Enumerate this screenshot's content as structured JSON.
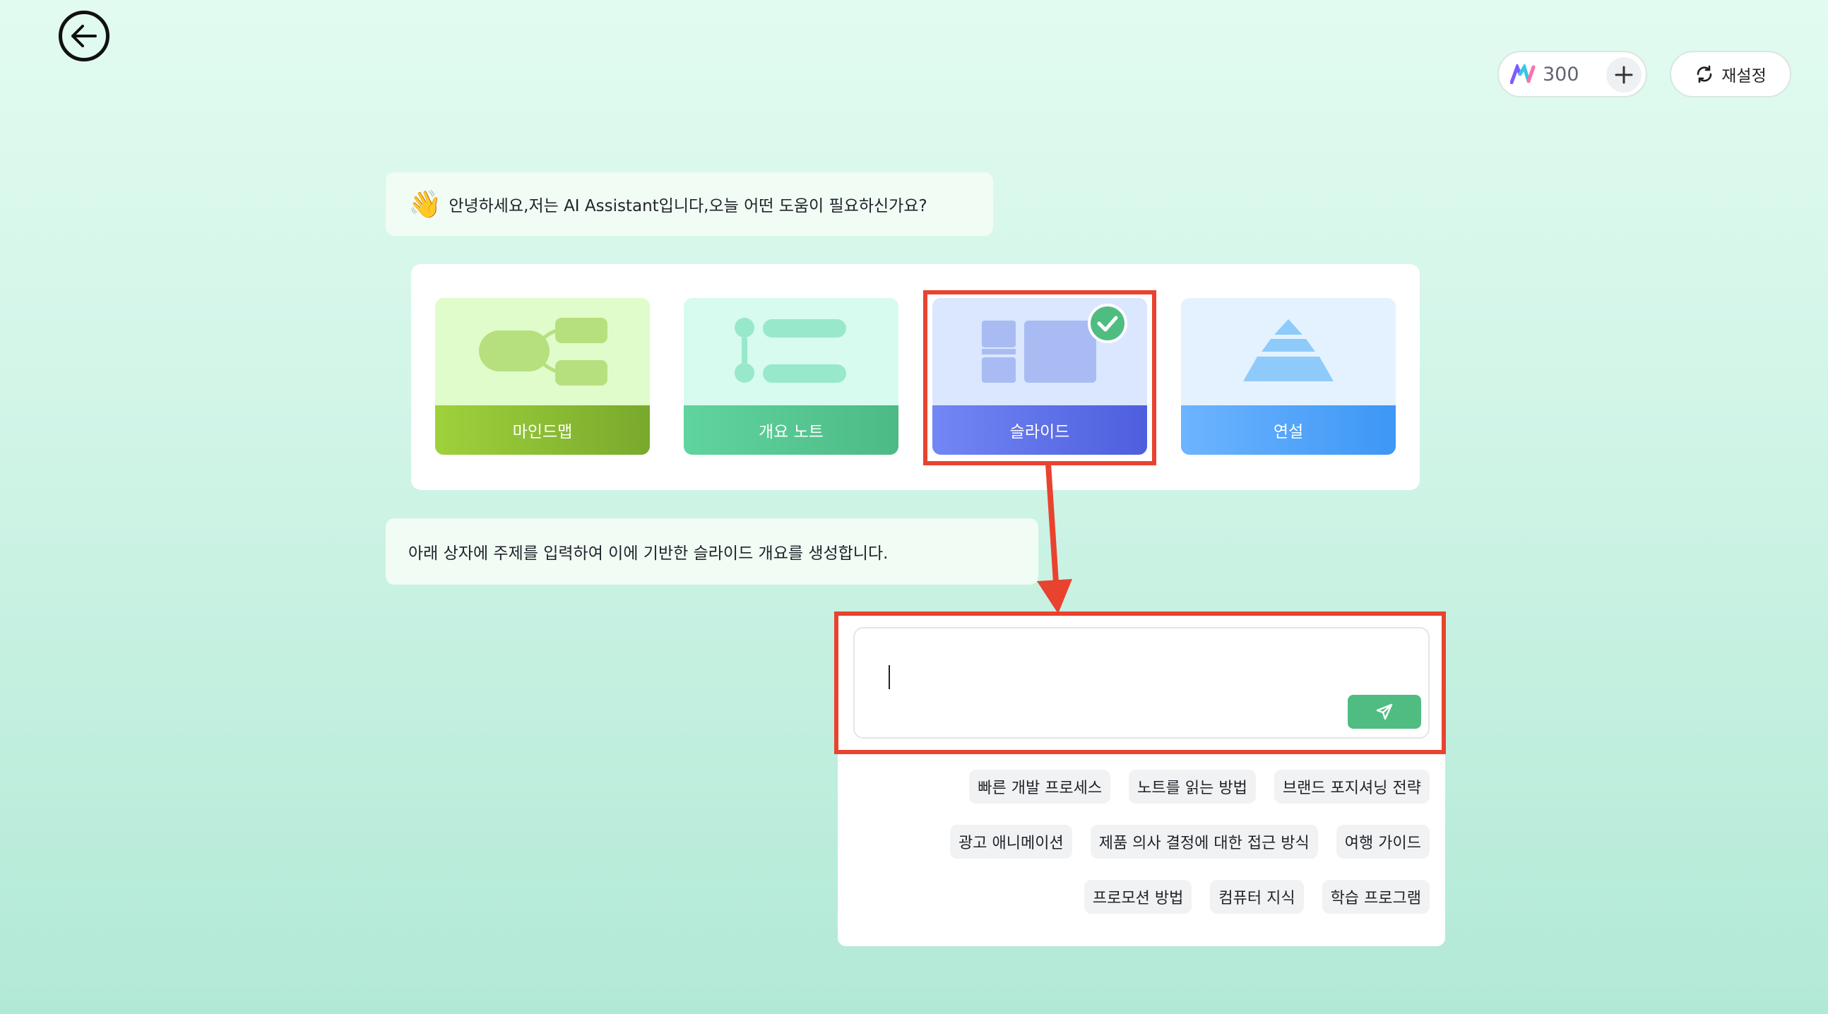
{
  "credits": {
    "amount": "300"
  },
  "reset": {
    "label": "재설정"
  },
  "greeting": {
    "emoji": "👋",
    "text": "안녕하세요,저는 AI Assistant입니다,오늘 어떤 도움이 필요하신가요?"
  },
  "modes": [
    {
      "label": "마인드맵"
    },
    {
      "label": "개요 노트"
    },
    {
      "label": "슬라이드",
      "selected": true
    },
    {
      "label": "연설"
    }
  ],
  "instruction": {
    "text": "아래 상자에 주제를 입력하여 이에 기반한 슬라이드 개요를 생성합니다."
  },
  "input": {
    "value": "",
    "placeholder": ""
  },
  "suggestions": [
    [
      "빠른 개발 프로세스",
      "노트를 읽는 방법",
      "브랜드 포지셔닝 전략"
    ],
    [
      "광고 애니메이션",
      "제품 의사 결정에 대한 접근 방식",
      "여행 가이드"
    ],
    [
      "프로모션 방법",
      "컴퓨터 지식",
      "학습 프로그램"
    ]
  ],
  "colors": {
    "highlight": "#e8432f",
    "send": "#4fbd82",
    "selected_check": "#4fbd82"
  }
}
